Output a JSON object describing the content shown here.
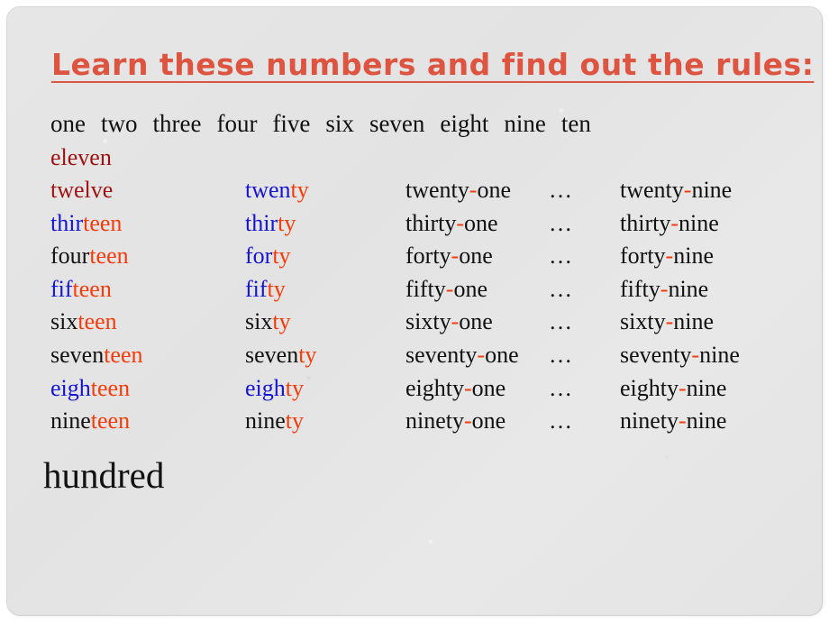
{
  "slide": {
    "title": "Learn these numbers and find out the rules:",
    "background_color": "#e5e5e5",
    "title_color": "#dd5540"
  },
  "colors": {
    "blue": "#1414d2",
    "orange": "#f43b0a",
    "black": "#111111",
    "maroon": "#9e1212"
  },
  "ones_row": {
    "words": [
      "one",
      "two",
      "three",
      "four",
      "five",
      "six",
      "seven",
      "eight",
      "nine",
      "ten"
    ]
  },
  "eleven_row": {
    "word": "eleven"
  },
  "ellipsis": "…",
  "rows": [
    {
      "teens": {
        "prefix": "twelve",
        "prefix_color": "maroon",
        "suffix": "",
        "suffix_color": "maroon"
      },
      "tens": {
        "prefix": "twen",
        "prefix_color": "blue",
        "suffix": "ty",
        "suffix_color": "orange"
      },
      "one": {
        "prefix": "twenty",
        "hyphen": "-",
        "suffix": "one"
      },
      "dots": "…",
      "nine": {
        "prefix": "twenty",
        "hyphen": "-",
        "suffix": "nine"
      }
    },
    {
      "teens": {
        "prefix": "thir",
        "prefix_color": "blue",
        "suffix": "teen",
        "suffix_color": "orange"
      },
      "tens": {
        "prefix": "thir",
        "prefix_color": "blue",
        "suffix": "ty",
        "suffix_color": "orange"
      },
      "one": {
        "prefix": "thirty",
        "hyphen": "-",
        "suffix": "one"
      },
      "dots": "…",
      "nine": {
        "prefix": "thirty",
        "hyphen": "-",
        "suffix": "nine"
      }
    },
    {
      "teens": {
        "prefix": "four",
        "prefix_color": "black",
        "suffix": "teen",
        "suffix_color": "orange"
      },
      "tens": {
        "prefix": "for",
        "prefix_color": "blue",
        "suffix": "ty",
        "suffix_color": "orange"
      },
      "one": {
        "prefix": "forty",
        "hyphen": "-",
        "suffix": "one"
      },
      "dots": "…",
      "nine": {
        "prefix": "forty",
        "hyphen": "-",
        "suffix": "nine"
      }
    },
    {
      "teens": {
        "prefix": "fif",
        "prefix_color": "blue",
        "suffix": "teen",
        "suffix_color": "orange"
      },
      "tens": {
        "prefix": "fif",
        "prefix_color": "blue",
        "suffix": "ty",
        "suffix_color": "orange"
      },
      "one": {
        "prefix": "fifty",
        "hyphen": "-",
        "suffix": "one"
      },
      "dots": "…",
      "nine": {
        "prefix": "fifty",
        "hyphen": "-",
        "suffix": "nine"
      }
    },
    {
      "teens": {
        "prefix": "six",
        "prefix_color": "black",
        "suffix": "teen",
        "suffix_color": "orange"
      },
      "tens": {
        "prefix": "six",
        "prefix_color": "black",
        "suffix": "ty",
        "suffix_color": "orange"
      },
      "one": {
        "prefix": "sixty",
        "hyphen": "-",
        "suffix": "one"
      },
      "dots": "…",
      "nine": {
        "prefix": "sixty",
        "hyphen": "-",
        "suffix": "nine"
      }
    },
    {
      "teens": {
        "prefix": "seven",
        "prefix_color": "black",
        "suffix": "teen",
        "suffix_color": "orange"
      },
      "tens": {
        "prefix": "seven",
        "prefix_color": "black",
        "suffix": "ty",
        "suffix_color": "orange"
      },
      "one": {
        "prefix": "seventy",
        "hyphen": "-",
        "suffix": "one"
      },
      "dots": "…",
      "nine": {
        "prefix": "seventy",
        "hyphen": "-",
        "suffix": "nine"
      }
    },
    {
      "teens": {
        "prefix": "eigh",
        "prefix_color": "blue",
        "suffix": "teen",
        "suffix_color": "orange"
      },
      "tens": {
        "prefix": "eigh",
        "prefix_color": "blue",
        "suffix": "ty",
        "suffix_color": "orange"
      },
      "one": {
        "prefix": "eighty",
        "hyphen": "-",
        "suffix": "one"
      },
      "dots": "…",
      "nine": {
        "prefix": "eighty",
        "hyphen": "-",
        "suffix": "nine"
      }
    },
    {
      "teens": {
        "prefix": "nine",
        "prefix_color": "black",
        "suffix": "teen",
        "suffix_color": "orange"
      },
      "tens": {
        "prefix": "nine",
        "prefix_color": "black",
        "suffix": "ty",
        "suffix_color": "orange"
      },
      "one": {
        "prefix": "ninety",
        "hyphen": "-",
        "suffix": "one"
      },
      "dots": "…",
      "nine": {
        "prefix": "ninety",
        "hyphen": "-",
        "suffix": "nine"
      }
    }
  ],
  "hundred": {
    "word": "hundred"
  }
}
